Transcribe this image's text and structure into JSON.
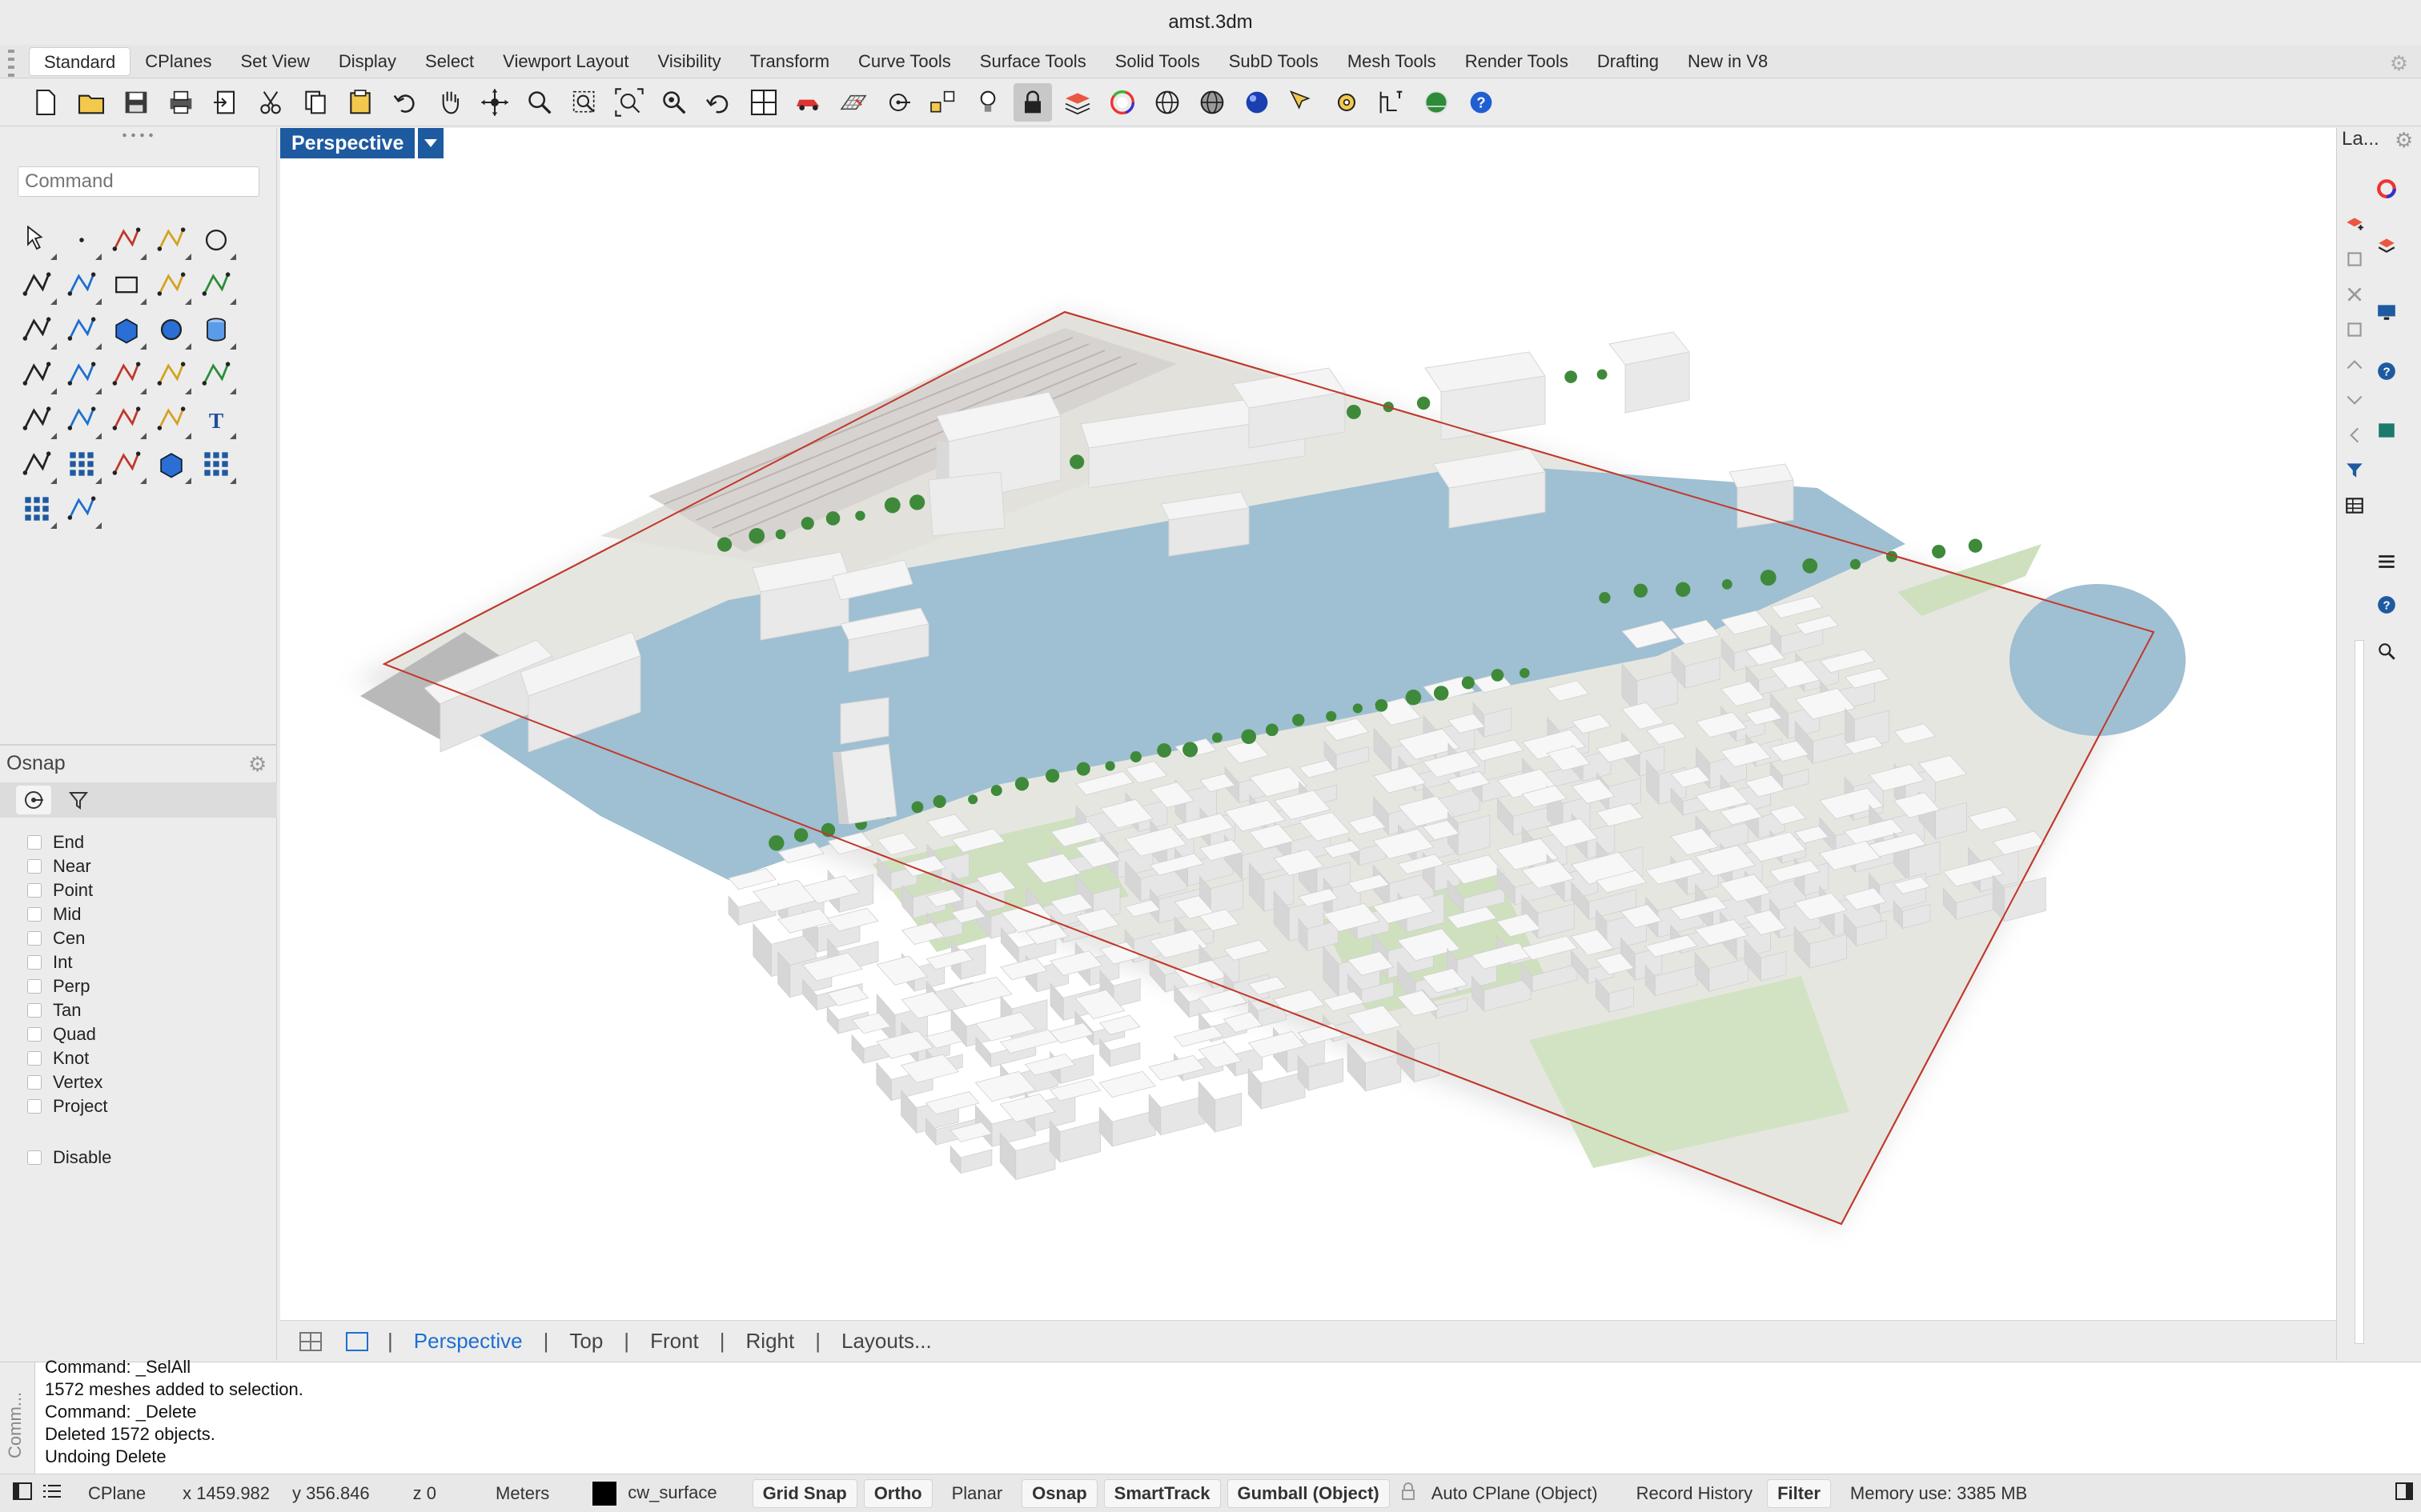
{
  "window": {
    "title": "amst.3dm"
  },
  "menu_tabs": [
    {
      "label": "Standard",
      "active": true
    },
    {
      "label": "CPlanes"
    },
    {
      "label": "Set View"
    },
    {
      "label": "Display"
    },
    {
      "label": "Select"
    },
    {
      "label": "Viewport Layout"
    },
    {
      "label": "Visibility"
    },
    {
      "label": "Transform"
    },
    {
      "label": "Curve Tools"
    },
    {
      "label": "Surface Tools"
    },
    {
      "label": "Solid Tools"
    },
    {
      "label": "SubD Tools"
    },
    {
      "label": "Mesh Tools"
    },
    {
      "label": "Render Tools"
    },
    {
      "label": "Drafting"
    },
    {
      "label": "New in V8"
    }
  ],
  "toolbar": [
    "new-file-icon",
    "open-folder-icon",
    "save-icon",
    "print-icon",
    "import-icon",
    "cut-icon",
    "copy-icon",
    "paste-icon",
    "undo-icon",
    "pan-hand-icon",
    "rotate-view-icon",
    "zoom-icon",
    "zoom-window-icon",
    "zoom-extents-icon",
    "zoom-selected-icon",
    "undo-view-icon",
    "four-viewports-icon",
    "car-render-icon",
    "grid-plane-icon",
    "cplane-icon",
    "named-cplanes-icon",
    "light-bulb-icon",
    "lock-icon",
    "layer-icon",
    "color-wheel-icon",
    "wireframe-sphere-icon",
    "shaded-sphere-icon",
    "rendered-sphere-icon",
    "select-filter-icon",
    "options-gear-icon",
    "grid-options-icon",
    "render-globe-icon",
    "help-icon"
  ],
  "command": {
    "placeholder": "Command"
  },
  "osnap": {
    "title": "Osnap",
    "items": [
      "End",
      "Near",
      "Point",
      "Mid",
      "Cen",
      "Int",
      "Perp",
      "Tan",
      "Quad",
      "Knot",
      "Vertex",
      "Project"
    ],
    "disable_label": "Disable"
  },
  "viewport": {
    "name": "Perspective"
  },
  "view_tabs": [
    {
      "label": "Perspective",
      "active": true
    },
    {
      "label": "Top"
    },
    {
      "label": "Front"
    },
    {
      "label": "Right"
    },
    {
      "label": "Layouts..."
    }
  ],
  "right_panel": {
    "title": "La..."
  },
  "command_history": {
    "side_label": "Comm...",
    "lines": [
      "Command: _SelAll",
      "1572 meshes added to selection.",
      "Command: _Delete",
      "Deleted 1572 objects.",
      "Undoing Delete"
    ]
  },
  "status": {
    "cplane": "CPlane",
    "x": "x 1459.982",
    "y": "y 356.846",
    "z": "z 0",
    "units": "Meters",
    "layer": "cw_surface",
    "layer_color": "#000000",
    "toggles": [
      {
        "label": "Grid Snap",
        "on": true
      },
      {
        "label": "Ortho",
        "on": true
      },
      {
        "label": "Planar",
        "on": false
      },
      {
        "label": "Osnap",
        "on": true
      },
      {
        "label": "SmartTrack",
        "on": true
      },
      {
        "label": "Gumball (Object)",
        "on": true
      }
    ],
    "auto_cplane": "Auto CPlane (Object)",
    "record_history": "Record History",
    "filter": "Filter",
    "memory": "Memory use: 3385 MB"
  },
  "colors": {
    "accent": "#1e5aa0",
    "water": "#9fbfd2",
    "ground": "#e4e4df",
    "parks": "#c6dbb4",
    "trees": "#3e8a3a",
    "buildings": "#f2f2f2",
    "outline": "#c0392b"
  }
}
